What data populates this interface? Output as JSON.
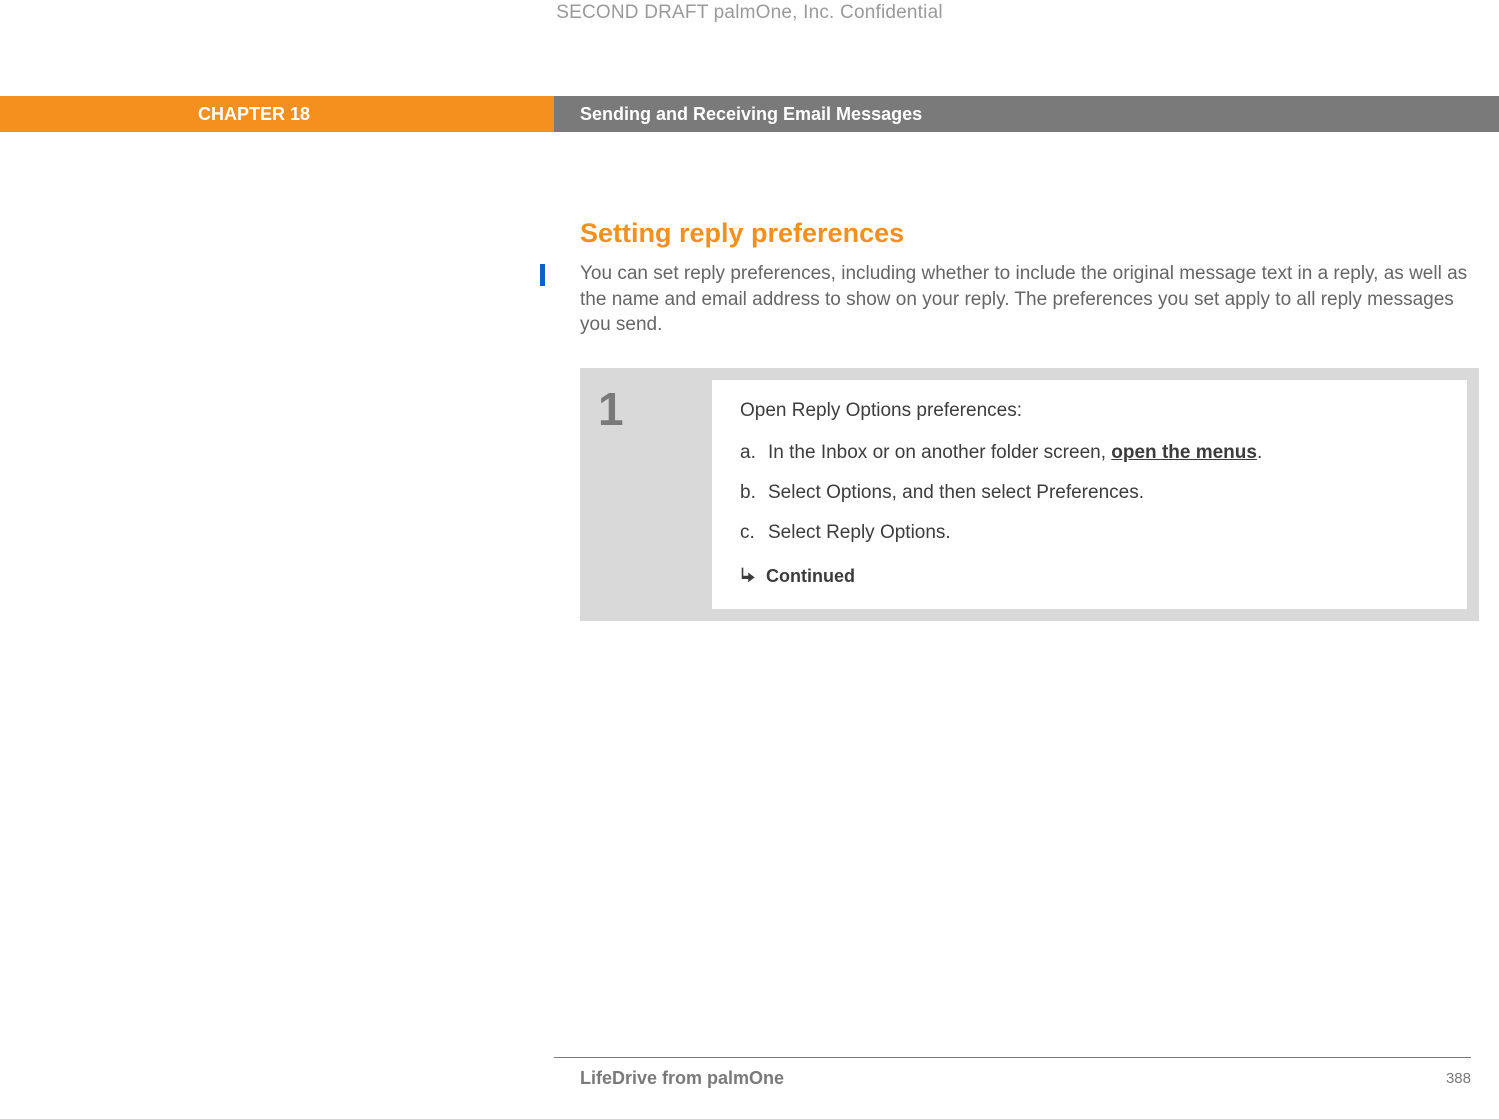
{
  "draft_header": "SECOND DRAFT palmOne, Inc.  Confidential",
  "banner": {
    "chapter": "CHAPTER 18",
    "title": "Sending and Receiving Email Messages"
  },
  "section": {
    "title": "Setting reply preferences",
    "intro": "You can set reply preferences, including whether to include the original message text in a reply, as well as the name and email address to show on your reply. The preferences you set apply to all reply messages you send."
  },
  "step": {
    "number": "1",
    "lead": "Open Reply Options preferences:",
    "items": [
      {
        "marker": "a.",
        "prefix": "In the Inbox or on another folder screen, ",
        "link": "open the menus",
        "suffix": "."
      },
      {
        "marker": "b.",
        "prefix": "Select Options, and then select Preferences.",
        "link": "",
        "suffix": ""
      },
      {
        "marker": "c.",
        "prefix": "Select Reply Options.",
        "link": "",
        "suffix": ""
      }
    ],
    "continued": "Continued"
  },
  "footer": {
    "product": "LifeDrive from palmOne",
    "page": "388"
  }
}
